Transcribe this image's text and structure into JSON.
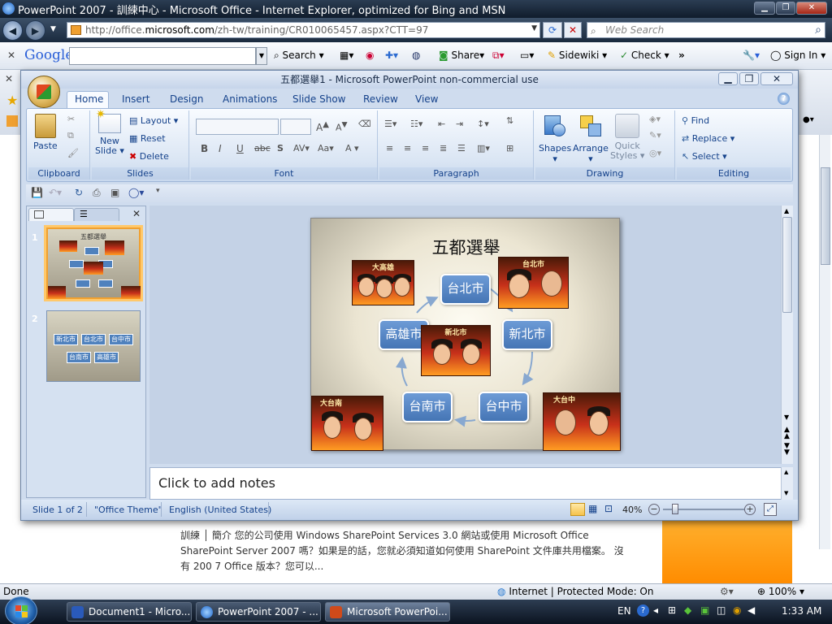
{
  "ie": {
    "title": "PowerPoint 2007 - 訓練中心 - Microsoft Office - Internet Explorer, optimized for Bing and MSN",
    "url_prefix": "http://office.",
    "url_domain": "microsoft.com",
    "url_rest": "/zh-tw/training/CR010065457.aspx?CTT=97",
    "search_placeholder": "Web Search",
    "status": "Done",
    "zone": "Internet | Protected Mode: On",
    "zoom": "100%"
  },
  "google_toolbar": {
    "brand": "Google",
    "search": "Search",
    "share": "Share",
    "sidewiki": "Sidewiki",
    "check": "Check",
    "signin": "Sign In"
  },
  "bg_page": {
    "line1": "訓練 │ 簡介 您的公司使用 Windows SharePoint Services 3.0 網站或使用 Microsoft Office",
    "line2": "SharePoint Server 2007 嗎？如果是的話，您就必須知道如何使用 SharePoint 文件庫共用檔案。 沒",
    "line3": "有 200 7 Office 版本？您可以..."
  },
  "ppt": {
    "title": "五都選舉1 - Microsoft PowerPoint non-commercial use",
    "tabs": [
      "Home",
      "Insert",
      "Design",
      "Animations",
      "Slide Show",
      "Review",
      "View"
    ],
    "groups": {
      "clipboard": "Clipboard",
      "slides": "Slides",
      "font": "Font",
      "paragraph": "Paragraph",
      "drawing": "Drawing",
      "editing": "Editing"
    },
    "buttons": {
      "paste": "Paste",
      "new_slide_1": "New",
      "new_slide_2": "Slide",
      "layout": "Layout",
      "reset": "Reset",
      "delete": "Delete",
      "shapes": "Shapes",
      "arrange": "Arrange",
      "quick_styles_1": "Quick",
      "quick_styles_2": "Styles",
      "find": "Find",
      "replace": "Replace",
      "select": "Select"
    },
    "slide": {
      "title": "五都選舉",
      "cities": {
        "taipei": "台北市",
        "newtaipei": "新北市",
        "taichung": "台中市",
        "tainan": "台南市",
        "kaohsiung": "高雄市"
      },
      "captions": {
        "kaohsiung": "大高雄",
        "taipei": "台北市",
        "newtaipei": "新北市",
        "tainan": "大台南",
        "taichung": "大台中"
      }
    },
    "thumbs": [
      {
        "num": "1",
        "title": "五都選舉"
      },
      {
        "num": "2"
      }
    ],
    "notes": "Click to add notes",
    "status": {
      "slide": "Slide 1 of 2",
      "theme": "\"Office Theme\"",
      "language": "English (United States)",
      "zoom": "40%"
    }
  },
  "taskbar": {
    "items": [
      "Document1 - Micro...",
      "PowerPoint 2007 - ...",
      "Microsoft PowerPoi..."
    ],
    "lang": "EN",
    "time": "1:33 AM"
  }
}
